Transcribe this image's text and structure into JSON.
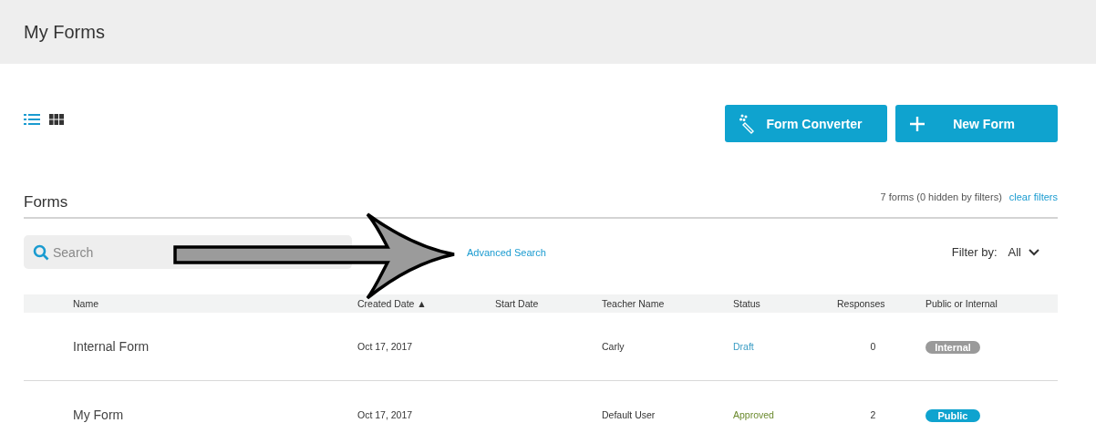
{
  "page": {
    "title": "My Forms"
  },
  "view_toggle": [
    {
      "kind": "list",
      "selected": true
    },
    {
      "kind": "grid",
      "selected": false
    }
  ],
  "buttons": [
    {
      "kind": "converter",
      "label": "Form Converter"
    },
    {
      "kind": "new",
      "label": "New Form"
    }
  ],
  "section": {
    "title": "Forms",
    "summary": "7 forms (0 hidden by filters)",
    "link": "clear filters"
  },
  "search": {
    "placeholder": "Search"
  },
  "advanced_search": "Advanced Search",
  "filter": {
    "label": "Filter by:",
    "value": "All"
  },
  "table": {
    "columns": [
      "Name",
      "Created Date ▲",
      "Start Date",
      "Teacher Name",
      "Status",
      "Responses",
      "Public or Internal"
    ],
    "rows": [
      {
        "name": "Internal Form",
        "created": "Oct 17, 2017",
        "teacher": "Carly",
        "status": {
          "kind": "draft",
          "label": "Draft"
        },
        "responses": "0",
        "visibility": {
          "kind": "internal",
          "label": "Internal"
        }
      },
      {
        "name": "My Form",
        "created": "Oct 17, 2017",
        "teacher": "Default User",
        "status": {
          "kind": "approved",
          "label": "Approved"
        },
        "responses": "2",
        "visibility": {
          "kind": "public",
          "label": "Public"
        }
      }
    ]
  }
}
